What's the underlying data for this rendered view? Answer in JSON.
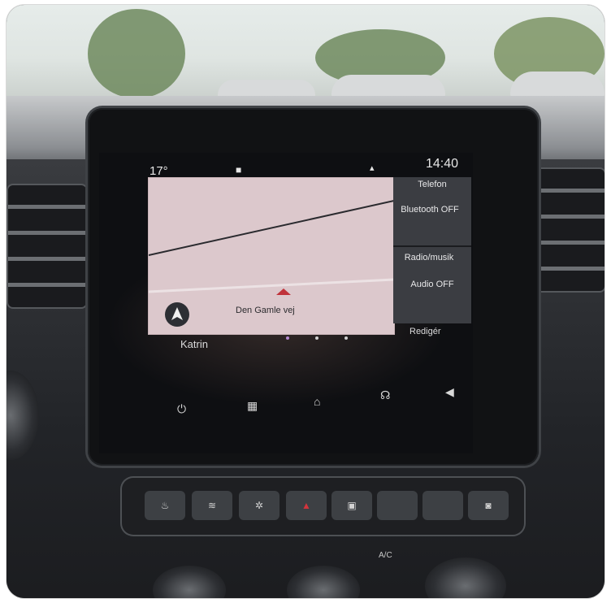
{
  "screen": {
    "status": {
      "temperature": "17°",
      "time": "14:40"
    },
    "side_panel": {
      "phone_title": "Telefon",
      "phone_status": "Bluetooth OFF",
      "radio_title": "Radio/musik",
      "radio_status": "Audio OFF",
      "edit_label": "Redigér"
    },
    "map": {
      "street": "Den Gamle vej"
    },
    "driver_name": "Katrin",
    "bottom_icons": [
      "power-icon",
      "apps-grid-icon",
      "home-icon",
      "voice-icon",
      "volume-icon"
    ]
  },
  "console": {
    "ac_label": "A/C",
    "button_icons": [
      "seat-heat-icon",
      "eco-icon",
      "fan-icon",
      "hazard-icon",
      "lock-icon",
      "blank-button",
      "blank-button",
      "seat-icon"
    ]
  }
}
